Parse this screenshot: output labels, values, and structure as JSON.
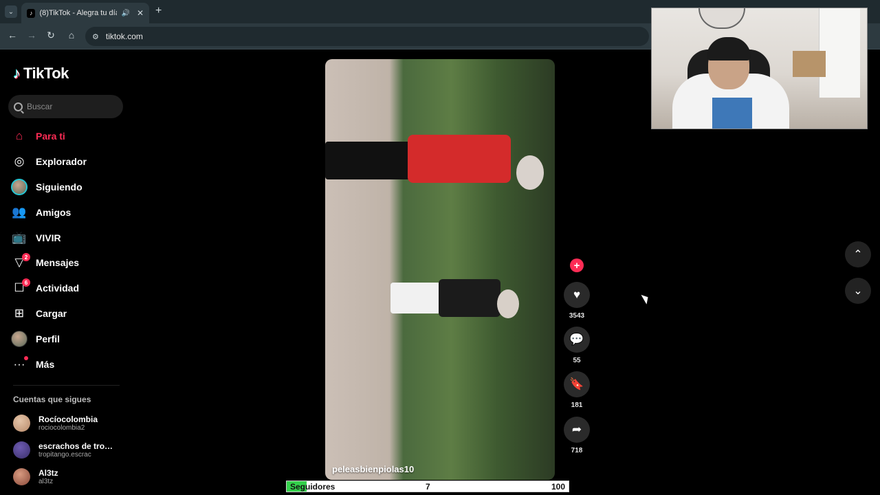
{
  "browser": {
    "tab_title": "(8)TikTok - Alegra tu día",
    "url": "tiktok.com"
  },
  "sidebar": {
    "logo_text": "TikTok",
    "search_placeholder": "Buscar",
    "nav": [
      {
        "label": "Para ti",
        "icon": "home-icon",
        "active": true
      },
      {
        "label": "Explorador",
        "icon": "compass-icon"
      },
      {
        "label": "Siguiendo",
        "icon": "following-avatar-icon"
      },
      {
        "label": "Amigos",
        "icon": "friends-icon"
      },
      {
        "label": "VIVIR",
        "icon": "live-tv-icon"
      },
      {
        "label": "Mensajes",
        "icon": "messages-icon",
        "badge": "2"
      },
      {
        "label": "Actividad",
        "icon": "activity-icon",
        "badge": "6"
      },
      {
        "label": "Cargar",
        "icon": "upload-icon"
      },
      {
        "label": "Perfil",
        "icon": "profile-avatar-icon"
      },
      {
        "label": "Más",
        "icon": "more-icon",
        "dot": true
      }
    ],
    "following_title": "Cuentas que sigues",
    "following": [
      {
        "name": "Rocíocolombia",
        "handle": "rociocolombia2",
        "color": "#b88a6a"
      },
      {
        "name": "escrachos de tropit...",
        "handle": "tropitango.escrac",
        "color": "#3a2f6b"
      },
      {
        "name": "Al3tz",
        "handle": "al3tz",
        "color": "#8a4a3a"
      }
    ]
  },
  "video": {
    "username": "peleasbienpiolas10"
  },
  "actions": {
    "likes": "3543",
    "comments": "55",
    "saves": "181",
    "shares": "718"
  },
  "follower_bar": {
    "label": "Seguidores",
    "current": "7",
    "goal": "100",
    "progress_fraction": 0.07
  },
  "colors": {
    "accent": "#fe2c55",
    "progress": "#35d14c"
  }
}
